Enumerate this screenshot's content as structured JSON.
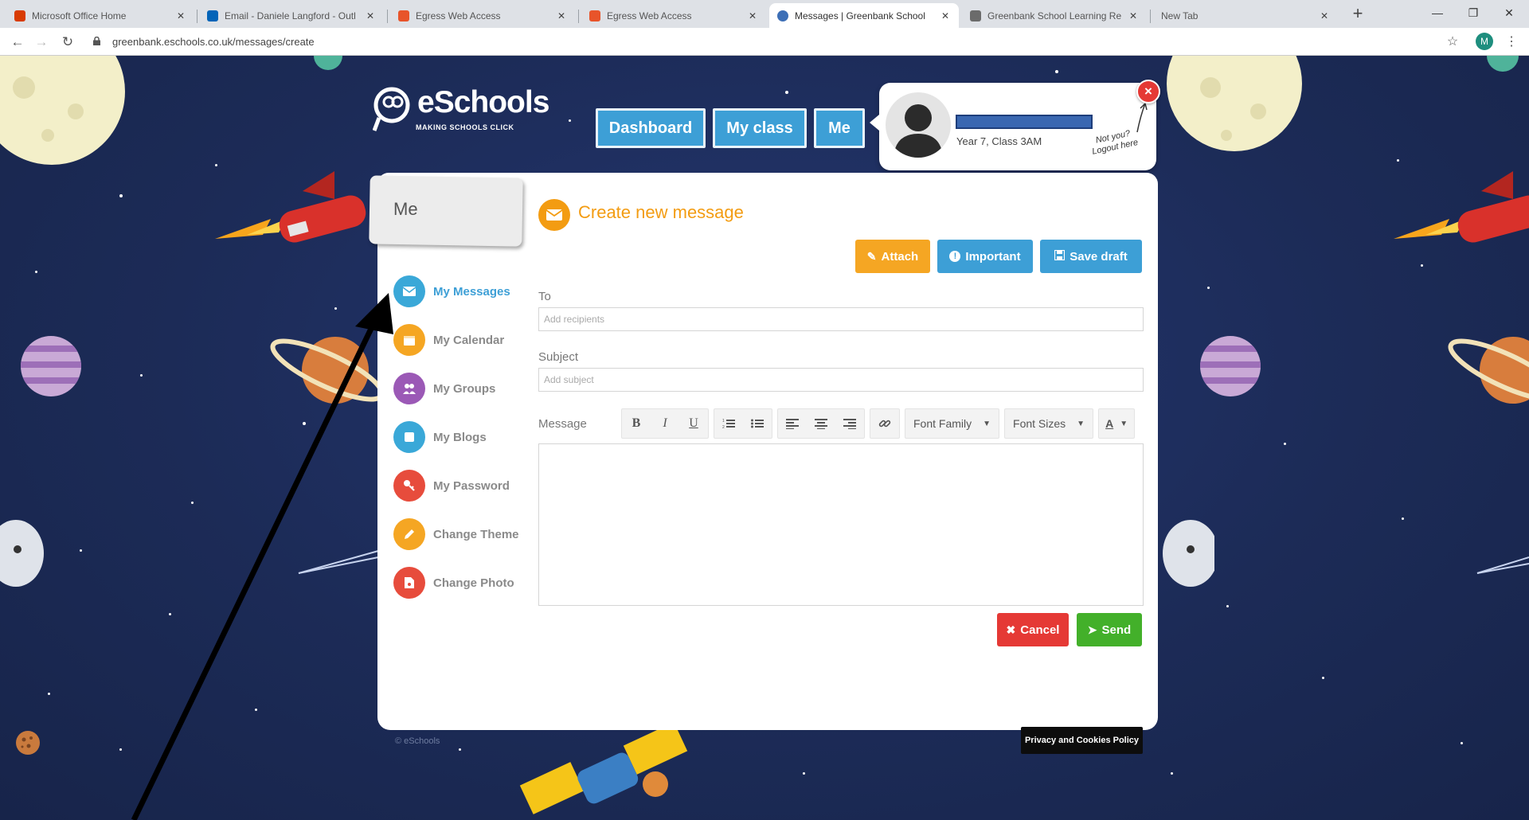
{
  "browser": {
    "tabs": [
      {
        "title": "Microsoft Office Home",
        "favicon_color": "#d83b01",
        "active": false
      },
      {
        "title": "Email - Daniele Langford - Outl",
        "favicon_color": "#0364b8",
        "active": false
      },
      {
        "title": "Egress Web Access",
        "favicon_color": "#e8542a",
        "active": false
      },
      {
        "title": "Egress Web Access",
        "favicon_color": "#e8542a",
        "active": false
      },
      {
        "title": "Messages | Greenbank School",
        "favicon_color": "#3d6fb6",
        "active": true
      },
      {
        "title": "Greenbank School Learning Re",
        "favicon_color": "#6b6b6b",
        "active": false
      },
      {
        "title": "New Tab",
        "favicon_color": "",
        "active": false
      }
    ],
    "new_tab_label": "+",
    "url": "greenbank.eschools.co.uk/messages/create",
    "profile_initial": "M"
  },
  "header": {
    "logo_text": "eSchools",
    "logo_tagline": "MAKING SCHOOLS CLICK",
    "nav": [
      {
        "label": "Dashboard",
        "active": false
      },
      {
        "label": "My class",
        "active": false
      },
      {
        "label": "Me",
        "active": true
      }
    ]
  },
  "user": {
    "class_label": "Year 7, Class 3AM",
    "logout_note": "Not you? Logout here",
    "close_label": "×"
  },
  "sidebar": {
    "section_title": "Me",
    "items": [
      {
        "label": "My Messages",
        "color": "#3aa8d8",
        "icon": "envelope-icon",
        "active": true
      },
      {
        "label": "My Calendar",
        "color": "#f5a623",
        "icon": "calendar-icon",
        "active": false
      },
      {
        "label": "My Groups",
        "color": "#9b59b6",
        "icon": "groups-icon",
        "active": false
      },
      {
        "label": "My Blogs",
        "color": "#3aa8d8",
        "icon": "blog-icon",
        "active": false
      },
      {
        "label": "My Password",
        "color": "#e74c3c",
        "icon": "key-icon",
        "active": false
      },
      {
        "label": "Change Theme",
        "color": "#f5a623",
        "icon": "pencil-icon",
        "active": false
      },
      {
        "label": "Change Photo",
        "color": "#e74c3c",
        "icon": "photo-icon",
        "active": false
      }
    ]
  },
  "compose": {
    "title": "Create new message",
    "buttons": {
      "attach": "Attach",
      "important": "Important",
      "save_draft": "Save draft",
      "cancel": "Cancel",
      "send": "Send"
    },
    "to_label": "To",
    "to_placeholder": "Add recipients",
    "subject_label": "Subject",
    "subject_placeholder": "Add subject",
    "message_label": "Message",
    "toolbar": {
      "font_family": "Font Family",
      "font_sizes": "Font Sizes",
      "text_color": "A"
    }
  },
  "footer": {
    "copyright": "© eSchools",
    "privacy": "Privacy and Cookies Policy"
  },
  "colors": {
    "brand_blue": "#3d9fd6",
    "accent_orange": "#f39c12",
    "cancel_red": "#e53935",
    "send_green": "#43b02a",
    "space_bg": "#1c2b57"
  }
}
